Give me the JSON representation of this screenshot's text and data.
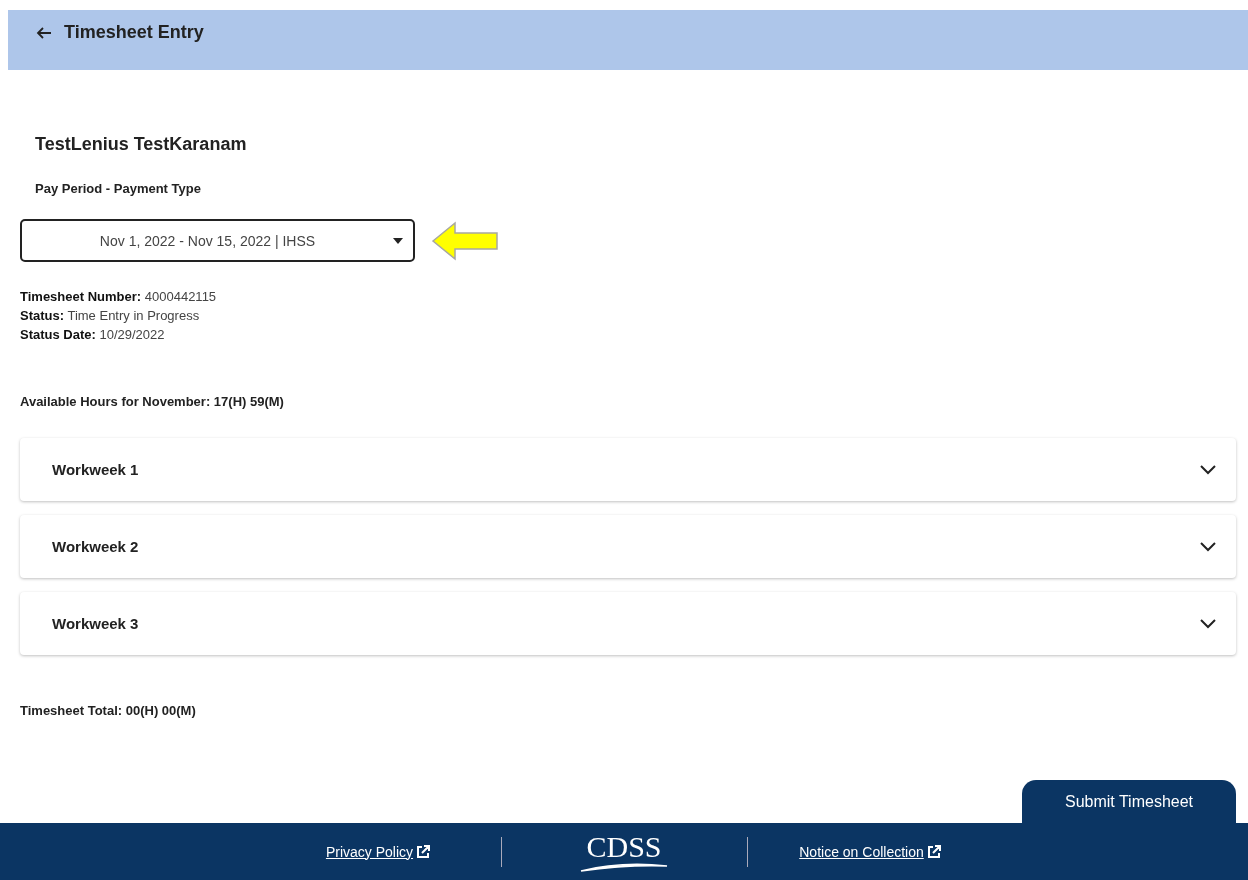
{
  "header": {
    "title": "Timesheet Entry"
  },
  "provider_name": "TestLenius TestKaranam",
  "pay_period": {
    "label": "Pay Period - Payment Type",
    "value": "Nov 1, 2022 - Nov 15, 2022 | IHSS"
  },
  "details": [
    "**Timesheet Number:** 4000442115",
    "**Status:** Time Entry in Progress",
    "**Status Date:** 10/29/2022"
  ],
  "available_hours": "Available Hours for November: 17(H) 59(M)",
  "workweeks": [
    {
      "label": "Workweek 1",
      "expanded": false
    },
    {
      "label": "Workweek 2",
      "expanded": false
    },
    {
      "label": "Workweek 3",
      "expanded": false
    }
  ],
  "timesheet_total": "Timesheet Total: 00(H) 00(M)",
  "submit_button": "Submit Timesheet",
  "footer": {
    "links": [
      "Privacy Policy",
      "Notice on Collection"
    ],
    "logo": "CDSS"
  }
}
